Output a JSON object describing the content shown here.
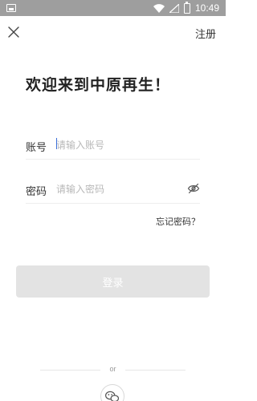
{
  "status_bar": {
    "time": "10:49",
    "battery_glyph": "x",
    "icons": [
      "sim-icon",
      "wifi-icon",
      "signal-icon",
      "battery-icon"
    ]
  },
  "header": {
    "close_icon": "close-icon",
    "register_label": "注册"
  },
  "welcome_title": "欢迎来到中原再生！",
  "form": {
    "account": {
      "label": "账号",
      "placeholder": "请输入账号"
    },
    "password": {
      "label": "密码",
      "placeholder": "请输入密码",
      "toggle_icon": "eye-slash-icon"
    },
    "forgot_label": "忘记密码？"
  },
  "login_button": {
    "label": "登录",
    "state": "disabled",
    "color": "#e3e3e3"
  },
  "alt_login": {
    "divider_text": "or",
    "wechat_icon": "wechat-icon"
  }
}
